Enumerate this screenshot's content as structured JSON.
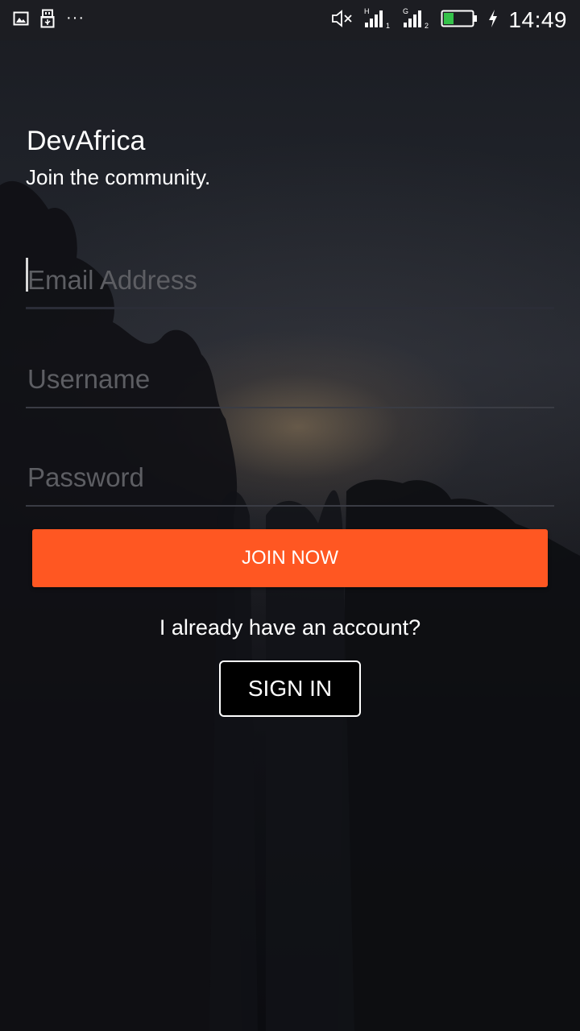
{
  "status_bar": {
    "time": "14:49",
    "notification_icons": [
      "image-icon",
      "usb-icon",
      "more-dots-icon"
    ],
    "more_dots": "···",
    "sim1_network": "H",
    "sim1_slot": "1",
    "sim2_network": "G",
    "sim2_slot": "2",
    "battery_level": 0.35,
    "charging": true,
    "muted": true
  },
  "app": {
    "title": "DevAfrica",
    "subtitle": "Join the community."
  },
  "form": {
    "email_placeholder": "Email Address",
    "email_value": "",
    "username_placeholder": "Username",
    "username_value": "",
    "password_placeholder": "Password",
    "password_value": ""
  },
  "actions": {
    "join_label": "JOIN NOW",
    "have_account_text": "I already have an account?",
    "sign_in_label": "SIGN IN"
  },
  "colors": {
    "accent": "#ff5722",
    "status_bar_bg": "#1c1d22",
    "background": "#0b0c10",
    "text": "#ffffff",
    "placeholder": "#5d5e63"
  }
}
